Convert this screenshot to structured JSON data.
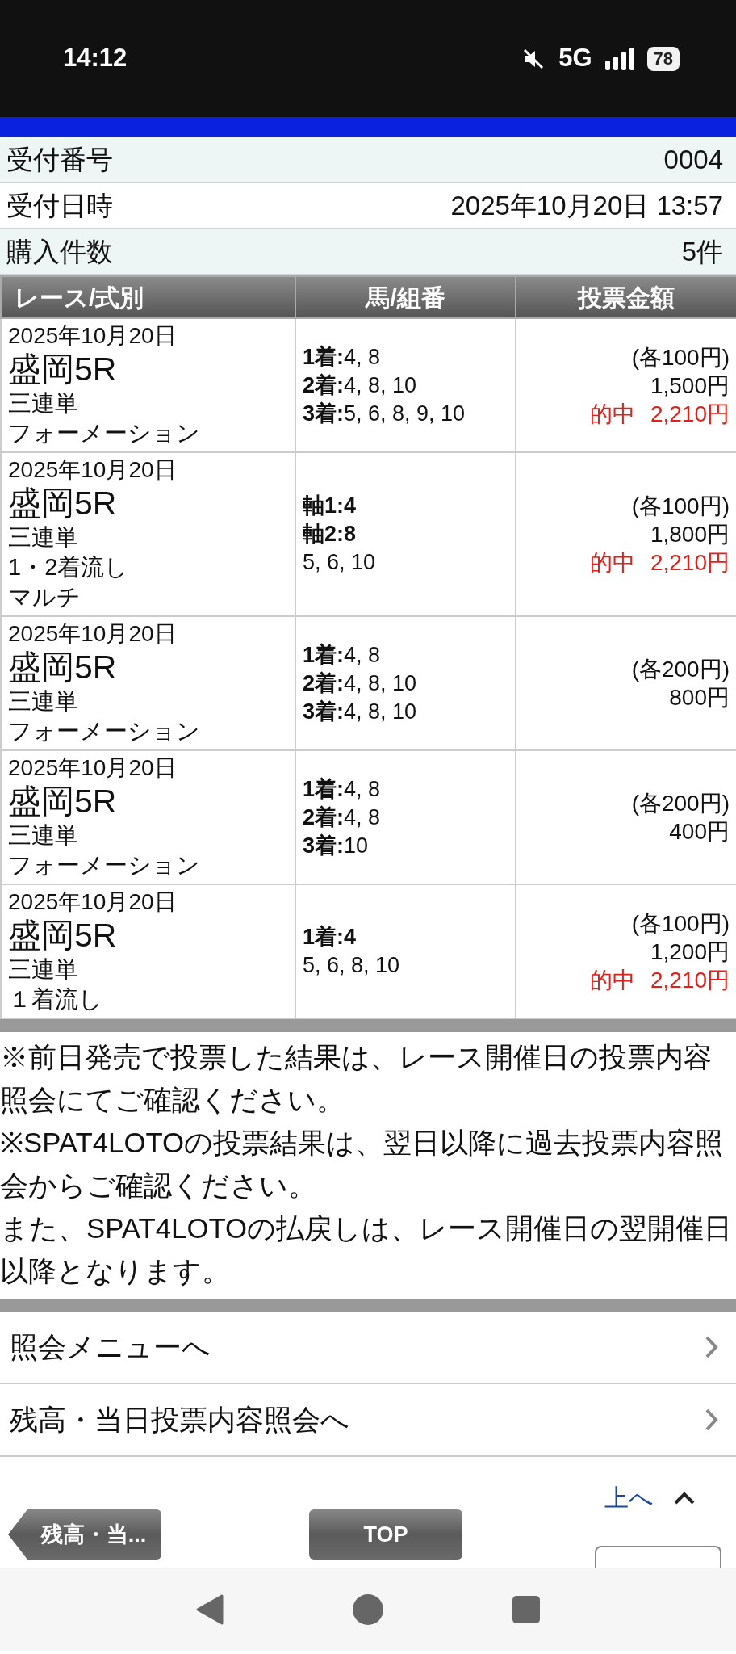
{
  "status_bar": {
    "time": "14:12",
    "network": "5G",
    "battery": "78"
  },
  "summary": [
    {
      "label": "受付番号",
      "value": "0004"
    },
    {
      "label": "受付日時",
      "value": "2025年10月20日 13:57"
    },
    {
      "label": "購入件数",
      "value": "5件"
    }
  ],
  "table": {
    "columns": [
      "レース/式別",
      "馬/組番",
      "投票金額"
    ],
    "rows": [
      {
        "date": "2025年10月20日",
        "venue": "盛岡5R",
        "bet_type": "三連単",
        "method": [
          "フォーメーション"
        ],
        "selections": [
          {
            "text": "**1着:**4, 8",
            "bold": false
          },
          {
            "text": "**2着:**4, 8, 10",
            "bold": false
          },
          {
            "text": "**3着:**5, 6, 8, 9, 10",
            "bold": false
          }
        ],
        "unit": "(各100円)",
        "total": "1,500円",
        "payout": "的中 2,210円"
      },
      {
        "date": "2025年10月20日",
        "venue": "盛岡5R",
        "bet_type": "三連単",
        "method": [
          "1・2着流し",
          "マルチ"
        ],
        "selections": [
          {
            "text": "軸1:4",
            "bold": true
          },
          {
            "text": "軸2:8",
            "bold": true
          },
          {
            "text": "5, 6, 10",
            "bold": false
          }
        ],
        "unit": "(各100円)",
        "total": "1,800円",
        "payout": "的中 2,210円"
      },
      {
        "date": "2025年10月20日",
        "venue": "盛岡5R",
        "bet_type": "三連単",
        "method": [
          "フォーメーション"
        ],
        "selections": [
          {
            "text": "**1着:**4, 8",
            "bold": false
          },
          {
            "text": "**2着:**4, 8, 10",
            "bold": false
          },
          {
            "text": "**3着:**4, 8, 10",
            "bold": false
          }
        ],
        "unit": "(各200円)",
        "total": "800円"
      },
      {
        "date": "2025年10月20日",
        "venue": "盛岡5R",
        "bet_type": "三連単",
        "method": [
          "フォーメーション"
        ],
        "selections": [
          {
            "text": "**1着:**4, 8",
            "bold": false
          },
          {
            "text": "**2着:**4, 8",
            "bold": false
          },
          {
            "text": "**3着:**10",
            "bold": false
          }
        ],
        "unit": "(各200円)",
        "total": "400円"
      },
      {
        "date": "2025年10月20日",
        "venue": "盛岡5R",
        "bet_type": "三連単",
        "method": [
          "１着流し"
        ],
        "selections": [
          {
            "text": "1着:4",
            "bold": true
          },
          {
            "text": "5, 6, 8, 10",
            "bold": false
          }
        ],
        "unit": "(各100円)",
        "total": "1,200円",
        "payout": "的中 2,210円"
      }
    ]
  },
  "notes": [
    "※前日発売で投票した結果は、レース開催日の投票内容照会にてご確認ください。",
    "※SPAT4LOTOの投票結果は、翌日以降に過去投票内容照会からご確認ください。",
    "また、SPAT4LOTOの払戻しは、レース開催日の翌開催日以降となります。"
  ],
  "links": [
    {
      "label": "照会メニューへ"
    },
    {
      "label": "残高・当日投票内容照会へ"
    }
  ],
  "footer": {
    "page_top_link": "上へ",
    "back_button": "残高・当...",
    "top_button": "TOP"
  }
}
